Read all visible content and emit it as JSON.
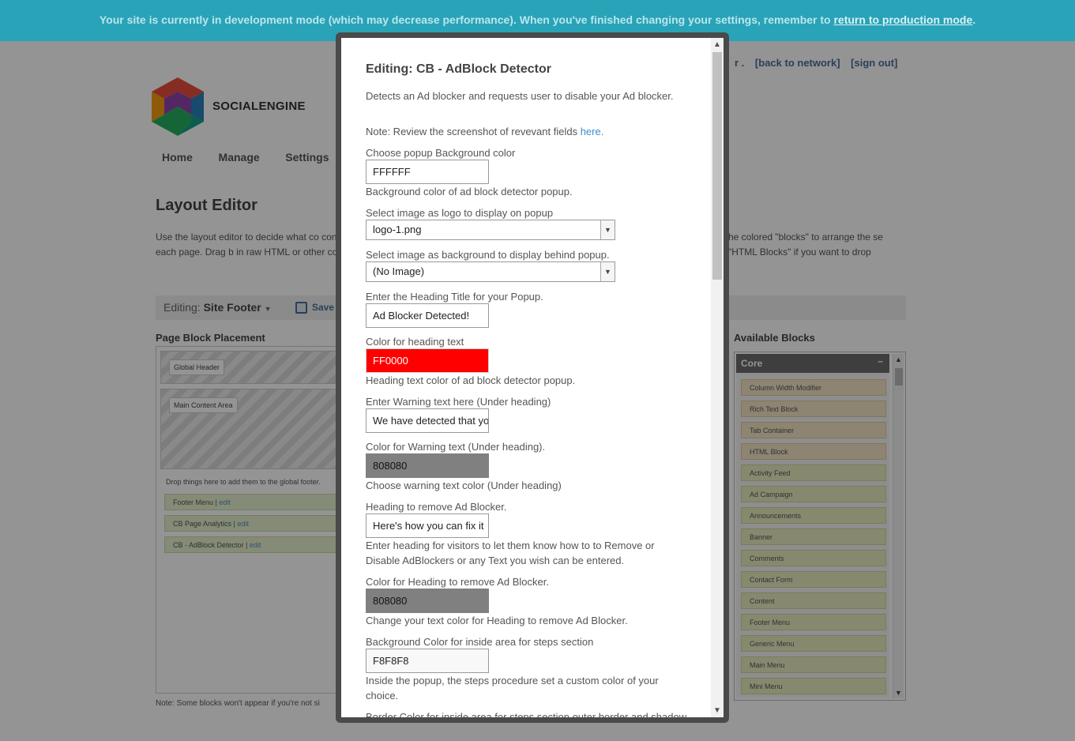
{
  "dev_banner": {
    "text": "Your site is currently in development mode (which may decrease performance). When you've finished changing your settings, remember to ",
    "link": "return to production mode",
    "end": "."
  },
  "header": {
    "top_links": {
      "prefix": "r .",
      "back": "[back to network]",
      "signout": "[sign out]"
    },
    "logo_text": "SOCIALENGINE",
    "nav": [
      "Home",
      "Manage",
      "Settings"
    ]
  },
  "layout_editor": {
    "title": "Layout Editor",
    "description_left": "Use the layout editor to decide what co content you want on each page. Drag b in raw HTML or other content. More info",
    "description_right": "he colored \"blocks\" to arrange the se \"HTML Blocks\" if you want to drop",
    "editing_label": "Editing:",
    "editing_value": "Site Footer",
    "save_label": "Save",
    "placement_title": "Page Block Placement",
    "global_header": "Global Header",
    "main_content": "Main Content Area",
    "drop_note": "Drop things here to add them to the global footer.",
    "footer_items": [
      {
        "name": "Footer Menu",
        "action": "edit"
      },
      {
        "name": "CB Page Analytics",
        "action": "edit"
      },
      {
        "name": "CB - AdBlock Detector",
        "action": "edit"
      }
    ],
    "bottom_note": "Note: Some blocks won't appear if you're not si",
    "available_title": "Available Blocks",
    "core_label": "Core",
    "core_toggle": "–",
    "available_blocks": [
      "Column Width Modifier",
      "Rich Text Block",
      "Tab Container",
      "HTML Block",
      "Activity Feed",
      "Ad Campaign",
      "Announcements",
      "Banner",
      "Comments",
      "Contact Form",
      "Content",
      "Footer Menu",
      "Generic Menu",
      "Main Menu",
      "Mini Menu"
    ]
  },
  "modal": {
    "title": "Editing: CB - AdBlock Detector",
    "description": "Detects an Ad blocker and requests user to disable your Ad blocker.",
    "note_prefix": "Note: Review the screenshot of revevant fields ",
    "note_link": "here.",
    "fields": {
      "bg_color_label": "Choose popup Background color",
      "bg_color_value": "FFFFFF",
      "bg_color_hint": "Background color of ad block detector popup.",
      "logo_label": "Select image as logo to display on popup",
      "logo_value": "logo-1.png",
      "bgimg_label": "Select image as background to display behind popup.",
      "bgimg_value": "(No Image)",
      "heading_label": "Enter the Heading Title for your Popup.",
      "heading_value": "Ad Blocker Detected!",
      "heading_color_label": "Color for heading text",
      "heading_color_value": "FF0000",
      "heading_color_hint": "Heading text color of ad block detector popup.",
      "warning_label": "Enter Warning text here (Under heading)",
      "warning_value": "We have detected that yo",
      "warning_color_label": "Color for Warning text (Under heading).",
      "warning_color_value": "808080",
      "warning_color_hint": "Choose warning text color (Under heading)",
      "remove_label": "Heading to remove Ad Blocker.",
      "remove_value": "Here's how you can fix it",
      "remove_hint": "Enter heading for visitors to let them know how to to Remove or Disable AdBlockers or any Text you wish can be entered.",
      "remove_color_label": "Color for Heading to remove Ad Blocker.",
      "remove_color_value": "808080",
      "remove_color_hint": "Change your text color for Heading to remove Ad Blocker.",
      "steps_bg_label": "Background Color for inside area for steps section",
      "steps_bg_value": "F8F8F8",
      "steps_bg_hint": "Inside the popup, the steps procedure set a custom color of your choice.",
      "border_label": "Border Color for inside area for steps section outer border and shadow"
    }
  },
  "colors": {
    "dev_banner": "#29a3b7",
    "heading_swatch": "#ff0000",
    "gray_swatch": "#808080",
    "steps_swatch": "#f8f8f8"
  }
}
